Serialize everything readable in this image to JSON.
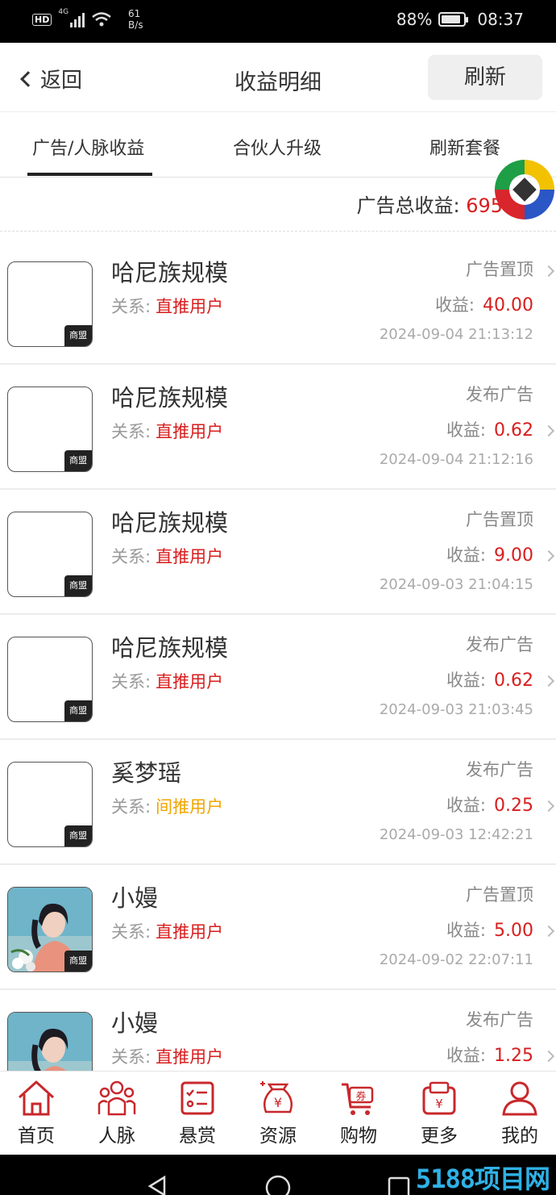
{
  "status_bar": {
    "hd": "HD",
    "network": "4G",
    "speed_value": "61",
    "speed_unit": "B/s",
    "battery": "88%",
    "time": "08:37"
  },
  "header": {
    "back_label": "返回",
    "title": "收益明细",
    "refresh_label": "刷新"
  },
  "tabs": [
    {
      "label": "广告/人脉收益",
      "active": true
    },
    {
      "label": "合伙人升级",
      "active": false
    },
    {
      "label": "刷新套餐",
      "active": false
    }
  ],
  "summary": {
    "label": "广告总收益:",
    "value": "695"
  },
  "list": {
    "relation_label": "关系:",
    "earning_label": "收益:",
    "badge": "商盟",
    "items": [
      {
        "name": "哈尼族规模",
        "relation": "直推用户",
        "type": "广告置顶",
        "amount": "40.00",
        "time": "2024-09-04 21:13:12",
        "avatar": "blank"
      },
      {
        "name": "哈尼族规模",
        "relation": "直推用户",
        "type": "发布广告",
        "amount": "0.62",
        "time": "2024-09-04 21:12:16",
        "avatar": "blank"
      },
      {
        "name": "哈尼族规模",
        "relation": "直推用户",
        "type": "广告置顶",
        "amount": "9.00",
        "time": "2024-09-03 21:04:15",
        "avatar": "blank"
      },
      {
        "name": "哈尼族规模",
        "relation": "直推用户",
        "type": "发布广告",
        "amount": "0.62",
        "time": "2024-09-03 21:03:45",
        "avatar": "blank"
      },
      {
        "name": "奚梦瑶",
        "relation": "间推用户",
        "type": "发布广告",
        "amount": "0.25",
        "time": "2024-09-03 12:42:21",
        "avatar": "blank"
      },
      {
        "name": "小嫚",
        "relation": "直推用户",
        "type": "广告置顶",
        "amount": "5.00",
        "time": "2024-09-02 22:07:11",
        "avatar": "photo"
      },
      {
        "name": "小嫚",
        "relation": "直推用户",
        "type": "发布广告",
        "amount": "1.25",
        "time": "",
        "avatar": "photo"
      }
    ]
  },
  "bottom_nav": [
    {
      "label": "首页",
      "icon": "home-icon"
    },
    {
      "label": "人脉",
      "icon": "people-icon"
    },
    {
      "label": "悬赏",
      "icon": "task-list-icon"
    },
    {
      "label": "资源",
      "icon": "money-bag-icon"
    },
    {
      "label": "购物",
      "icon": "shopping-cart-icon"
    },
    {
      "label": "更多",
      "icon": "wallet-icon"
    },
    {
      "label": "我的",
      "icon": "user-icon"
    }
  ],
  "watermark": "5188项目网",
  "colors": {
    "accent_red": "#d81e1e",
    "indirect_orange": "#f0a500",
    "nav_icon_red": "#c8282c"
  }
}
